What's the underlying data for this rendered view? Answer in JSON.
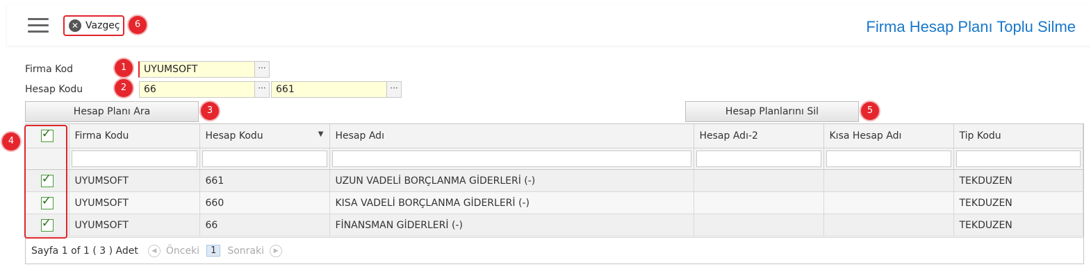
{
  "header": {
    "cancel_label": "Vazgeç",
    "title": "Firma Hesap Planı Toplu Silme"
  },
  "badges": [
    "1",
    "2",
    "3",
    "4",
    "5",
    "6"
  ],
  "form": {
    "firma_kod_label": "Firma Kod",
    "firma_kod_value": "UYUMSOFT",
    "hesap_kodu_label": "Hesap Kodu",
    "hesap_kodu_from": "66",
    "hesap_kodu_to": "661",
    "lookup_glyph": "···"
  },
  "buttons": {
    "search": "Hesap Planı Ara",
    "delete": "Hesap Planlarını Sil"
  },
  "grid": {
    "columns": [
      "Firma Kodu",
      "Hesap Kodu",
      "Hesap Adı",
      "Hesap Adı-2",
      "Kısa Hesap Adı",
      "Tip Kodu"
    ],
    "rows": [
      {
        "firma": "UYUMSOFT",
        "kod": "661",
        "ad": "UZUN VADELİ BORÇLANMA GİDERLERİ (-)",
        "ad2": "",
        "kisa": "",
        "tip": "TEKDUZEN",
        "checked": true
      },
      {
        "firma": "UYUMSOFT",
        "kod": "660",
        "ad": "KISA VADELİ BORÇLANMA GİDERLERİ (-)",
        "ad2": "",
        "kisa": "",
        "tip": "TEKDUZEN",
        "checked": true
      },
      {
        "firma": "UYUMSOFT",
        "kod": "66",
        "ad": "FİNANSMAN GİDERLERİ (-)",
        "ad2": "",
        "kisa": "",
        "tip": "TEKDUZEN",
        "checked": true
      }
    ]
  },
  "pager": {
    "summary": "Sayfa 1 of 1 ( 3 ) Adet",
    "prev": "Önceki",
    "page": "1",
    "next": "Sonraki"
  },
  "colors": {
    "accent": "#1877c9",
    "highlight": "#e0242b",
    "field_bg": "#ffffd8"
  }
}
